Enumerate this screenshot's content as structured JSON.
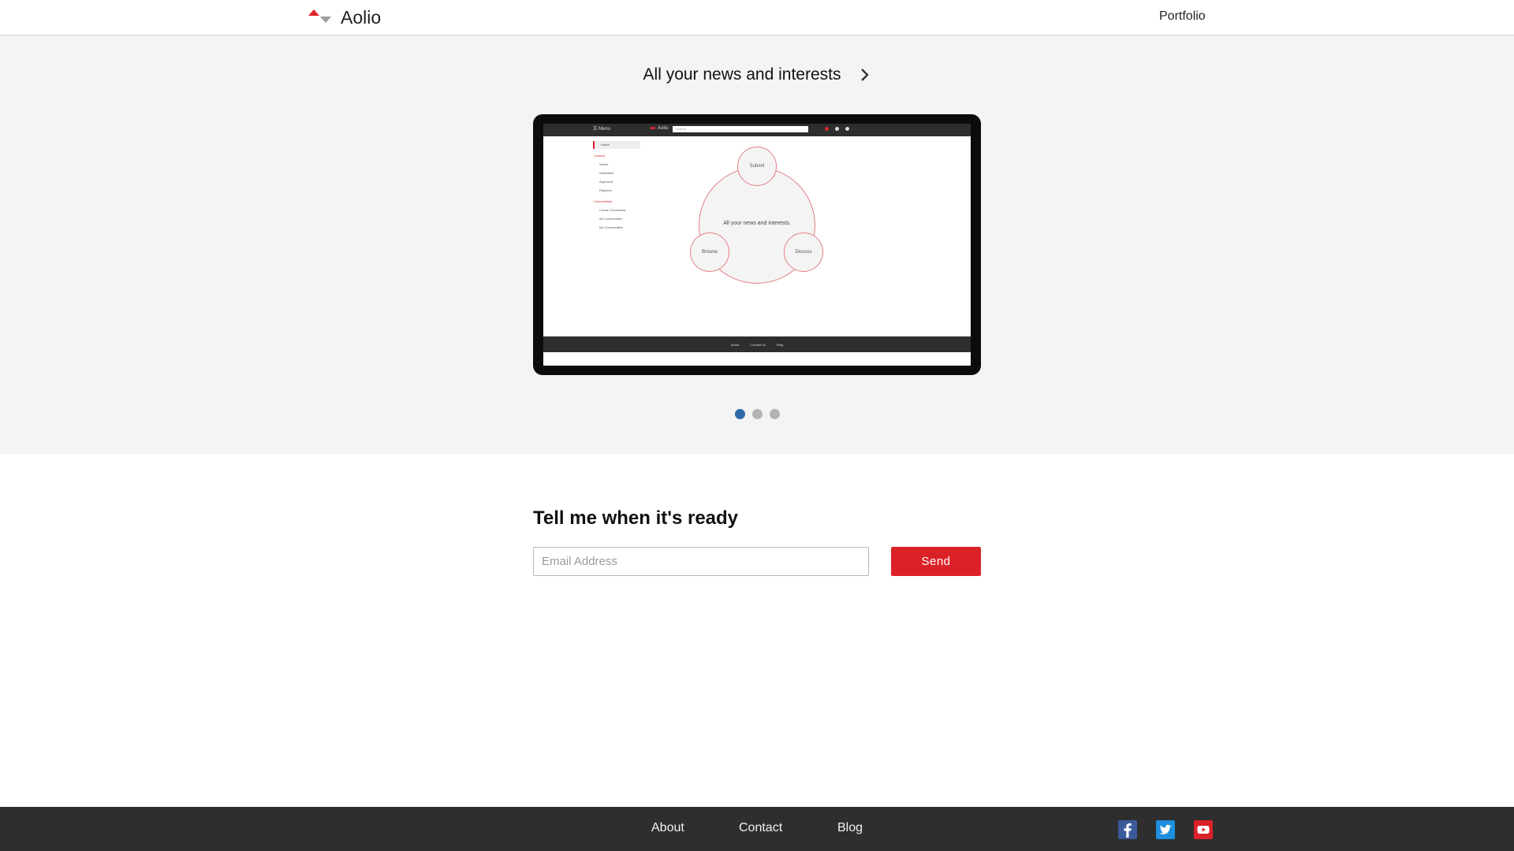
{
  "header": {
    "brand": "Aolio",
    "nav_portfolio": "Portfolio"
  },
  "hero": {
    "title": "All your news and interests",
    "preview": {
      "menu_label": "☰ Menu",
      "brand": "Aolio",
      "search_placeholder": "Search",
      "sidebar": {
        "home": "Home",
        "section_content": "Content",
        "content_items": [
          "Saved",
          "Submitted",
          "Approved",
          "Rejected"
        ],
        "section_communities": "Communities",
        "community_items": [
          "Create Community",
          "All Communities",
          "My Communities"
        ]
      },
      "center_text": "All your news and interests.",
      "bubbles": {
        "submit": "Submit",
        "browse": "Browse",
        "discuss": "Discuss"
      },
      "footer_links": [
        "About",
        "Contact Us",
        "Blog"
      ]
    },
    "carousel": {
      "count": 3,
      "active_index": 0
    }
  },
  "signup": {
    "title": "Tell me when it's ready",
    "email_placeholder": "Email Address",
    "email_value": "",
    "send_label": "Send"
  },
  "footer": {
    "links": [
      "About",
      "Contact",
      "Blog"
    ],
    "social_icons": [
      "facebook-icon",
      "twitter-icon",
      "youtube-icon"
    ]
  },
  "colors": {
    "accent_red": "#db2128",
    "active_dot": "#2f6bab",
    "footer_bg": "#2e2e2e",
    "hero_bg": "#f4f4f4"
  }
}
